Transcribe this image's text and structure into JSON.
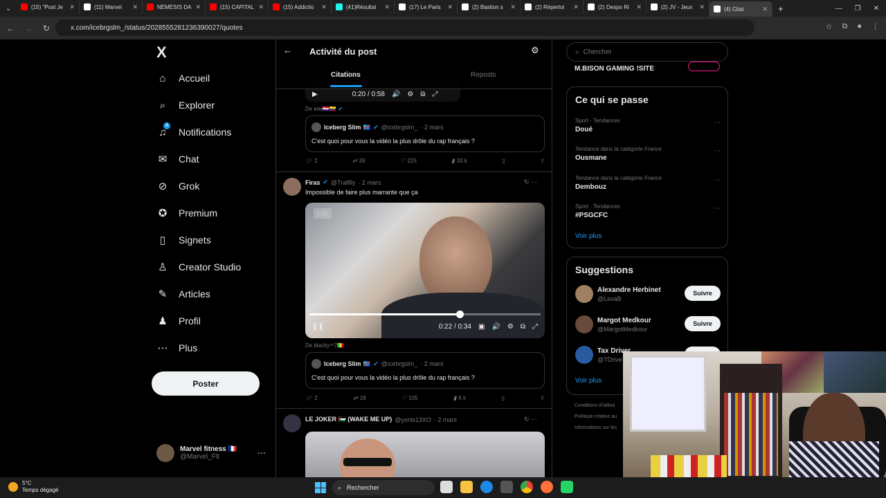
{
  "browser": {
    "tabs": [
      {
        "label": "(15) \"Post Je",
        "color": "#ff0000"
      },
      {
        "label": "(11) Marvel",
        "color": "#ffffff"
      },
      {
        "label": "NÉMÉSIS DA",
        "color": "#ff0000"
      },
      {
        "label": "(15) CAPITAL",
        "color": "#ff0000"
      },
      {
        "label": "(15) Addictio",
        "color": "#ff0000"
      },
      {
        "label": "(41)Résultat",
        "color": "#25f4ee"
      },
      {
        "label": "(17) Le Paris",
        "color": "#ffffff"
      },
      {
        "label": "(2) Bastion s",
        "color": "#ffffff"
      },
      {
        "label": "(2) Répertoi",
        "color": "#ffffff"
      },
      {
        "label": "(2) Despo Ri",
        "color": "#ffffff"
      },
      {
        "label": "(2) JV - Jeux",
        "color": "#ffffff"
      },
      {
        "label": "(4) Citat",
        "color": "#ffffff"
      }
    ],
    "url": "x.com/icebrgslm_/status/2028555281236390027/quotes"
  },
  "sidebar": {
    "logo": "X",
    "items": [
      {
        "label": "Accueil",
        "icon": "⌂"
      },
      {
        "label": "Explorer",
        "icon": "⌕"
      },
      {
        "label": "Notifications",
        "icon": "♫",
        "badge": "4"
      },
      {
        "label": "Chat",
        "icon": "✉"
      },
      {
        "label": "Grok",
        "icon": "⊘"
      },
      {
        "label": "Premium",
        "icon": "✪"
      },
      {
        "label": "Signets",
        "icon": "▯"
      },
      {
        "label": "Creator Studio",
        "icon": "♙"
      },
      {
        "label": "Articles",
        "icon": "✎"
      },
      {
        "label": "Profil",
        "icon": "♟"
      },
      {
        "label": "Plus",
        "icon": "⋯"
      }
    ],
    "post_button": "Poster",
    "account": {
      "name": "Marvel fitness 🇫🇷",
      "handle": "@Marvel_Flt"
    }
  },
  "main": {
    "back": "←",
    "title": "Activité du post",
    "tabs": [
      "Citations",
      "Reposts"
    ],
    "top_video": {
      "time": "0:20 / 0:58"
    },
    "post1": {
      "from": "De ʙяк🇭🇷🇨🇴",
      "quote": {
        "name": "Iceberg Slim 🇨🇩",
        "handle": "@icebrgslm_",
        "date": "· 2 mars",
        "text": "C'est quoi pour vous la vidéo la plus drôle du rap français ?"
      },
      "stats": {
        "replies": "2",
        "reposts": "26",
        "likes": "225",
        "views": "33 k"
      }
    },
    "post2": {
      "name": "Firas",
      "handle": "@Trafllly",
      "date": "· 2 mars",
      "text": "Impossible de faire plus marrante que ça",
      "video": {
        "rate": "1.00",
        "time": "0:22 / 0:34",
        "progress": 0.65
      },
      "from": "De blacky⁶⁶7🇲🇱",
      "quote": {
        "name": "Iceberg Slim 🇨🇩",
        "handle": "@icebrgslm_",
        "date": "· 2 mars",
        "text": "C'est quoi pour vous la vidéo la plus drôle du rap français ?"
      },
      "stats": {
        "replies": "2",
        "reposts": "19",
        "likes": "105",
        "views": "6 k"
      }
    },
    "post3": {
      "name": "LE JOKER 🇵🇸 (WAKE ME UP)",
      "handle": "@yxnls13XO",
      "date": "· 2 mars"
    }
  },
  "right": {
    "search_placeholder": "Chercher",
    "top_item": "M.BISON GAMING !SITE",
    "trends_title": "Ce qui se passe",
    "trends": [
      {
        "cat": "Sport · Tendances",
        "name": "Doué"
      },
      {
        "cat": "Tendance dans la catégorie France",
        "name": "Ousmane"
      },
      {
        "cat": "Tendance dans la catégorie France",
        "name": "Dembouz"
      },
      {
        "cat": "Sport · Tendances",
        "name": "#PSGCFC"
      }
    ],
    "see_more": "Voir plus",
    "sugg_title": "Suggestions",
    "suggestions": [
      {
        "name": "Alexandre Herbinet",
        "handle": "@LexaB",
        "follow": "Suivre"
      },
      {
        "name": "Margot Medkour",
        "handle": "@MargotMedkour",
        "follow": "Suivre"
      },
      {
        "name": "Tax Driver",
        "handle": "@TDrive",
        "follow": "Suivre"
      }
    ],
    "see_more2": "Voir plus",
    "footer": [
      "Conditions d'utilisa",
      "Politique relative au",
      "Informations sur les"
    ]
  },
  "taskbar": {
    "temp": "5°C",
    "weather": "Temps dégagé",
    "search": "Rechercher"
  }
}
